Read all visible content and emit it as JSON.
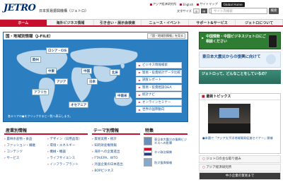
{
  "header": {
    "logo": "JETRO",
    "org_name": "日本貿易振興機構（ジェトロ）",
    "util_links": [
      "アジア経済研究所",
      "English",
      "サイトマップ"
    ],
    "global_link": "Global Home",
    "text_size_label": "文字サイズ",
    "text_sizes": [
      "小",
      "中",
      "大"
    ],
    "search_placeholder": "サイト内検索",
    "search_button": "検索"
  },
  "nav": {
    "items": [
      "ホーム",
      "海外ビジネス情報",
      "引き合い・展示会検索",
      "ニュース・イベント",
      "サポート&サービス",
      "ジェトロについて"
    ],
    "active_index": 0
  },
  "map": {
    "title": "国・地域別情報（J-FILE）",
    "button": "「国・地域別情報」を見る",
    "regions": [
      "ロシア・CIS",
      "欧州",
      "中東",
      "アフリカ",
      "アジア",
      "中国",
      "日本",
      "北米",
      "中南米",
      "オセアニア"
    ],
    "services": [
      "ビジネス情報検索",
      "貿易・投資統計データ比較",
      "調査レポート",
      "貿易・投資相談Q&A",
      "統計ナビ",
      "オンラインセミナー",
      "世界の国際動向"
    ],
    "note": "各エリアの●をクリックすると一覧へ表示します。"
  },
  "promos": {
    "green_text": "中国情勢・中国ビジネスジェトロにご相談ください",
    "blue_text": "東日本大震災からの復興に向けて",
    "tv_text": "ジェトロって、どんなことをしているの？"
  },
  "topics": {
    "title": "最新トピックス",
    "caption": "●本國で「アジア太平洋地域貿易促進セミナー」開催",
    "links": [
      "ジェトロの主な取り組み",
      "アジア経済研究所",
      "中小企業の貿易まで"
    ]
  },
  "industry": {
    "title": "産業別情報",
    "items": [
      "農林水産物・食品",
      "デザイン（日用品等）",
      "ファッション・繊維",
      "環境・エネルギー",
      "コンテンツ",
      "機械・機器",
      "サービス",
      "ライフサイエンス",
      "",
      "インフラ・プラント"
    ]
  },
  "theme": {
    "title": "テーマ別情報",
    "items": [
      "貿易実務・統計",
      "知的財産権情報",
      "海外への企業進出",
      "FTA/EPA、WTO",
      "外国企業の日本進出",
      "BOPビジネス"
    ]
  },
  "feature": {
    "title": "特集",
    "items": [
      "東日本大震災の復興ビジネスへの影響",
      "タイ政治情勢",
      "防災復興情報"
    ]
  },
  "colors": {
    "brand_red": "#c8102e",
    "map_blue": "#2b7fc0",
    "navy": "#002e6e",
    "promo_green": "#2e7d32"
  }
}
